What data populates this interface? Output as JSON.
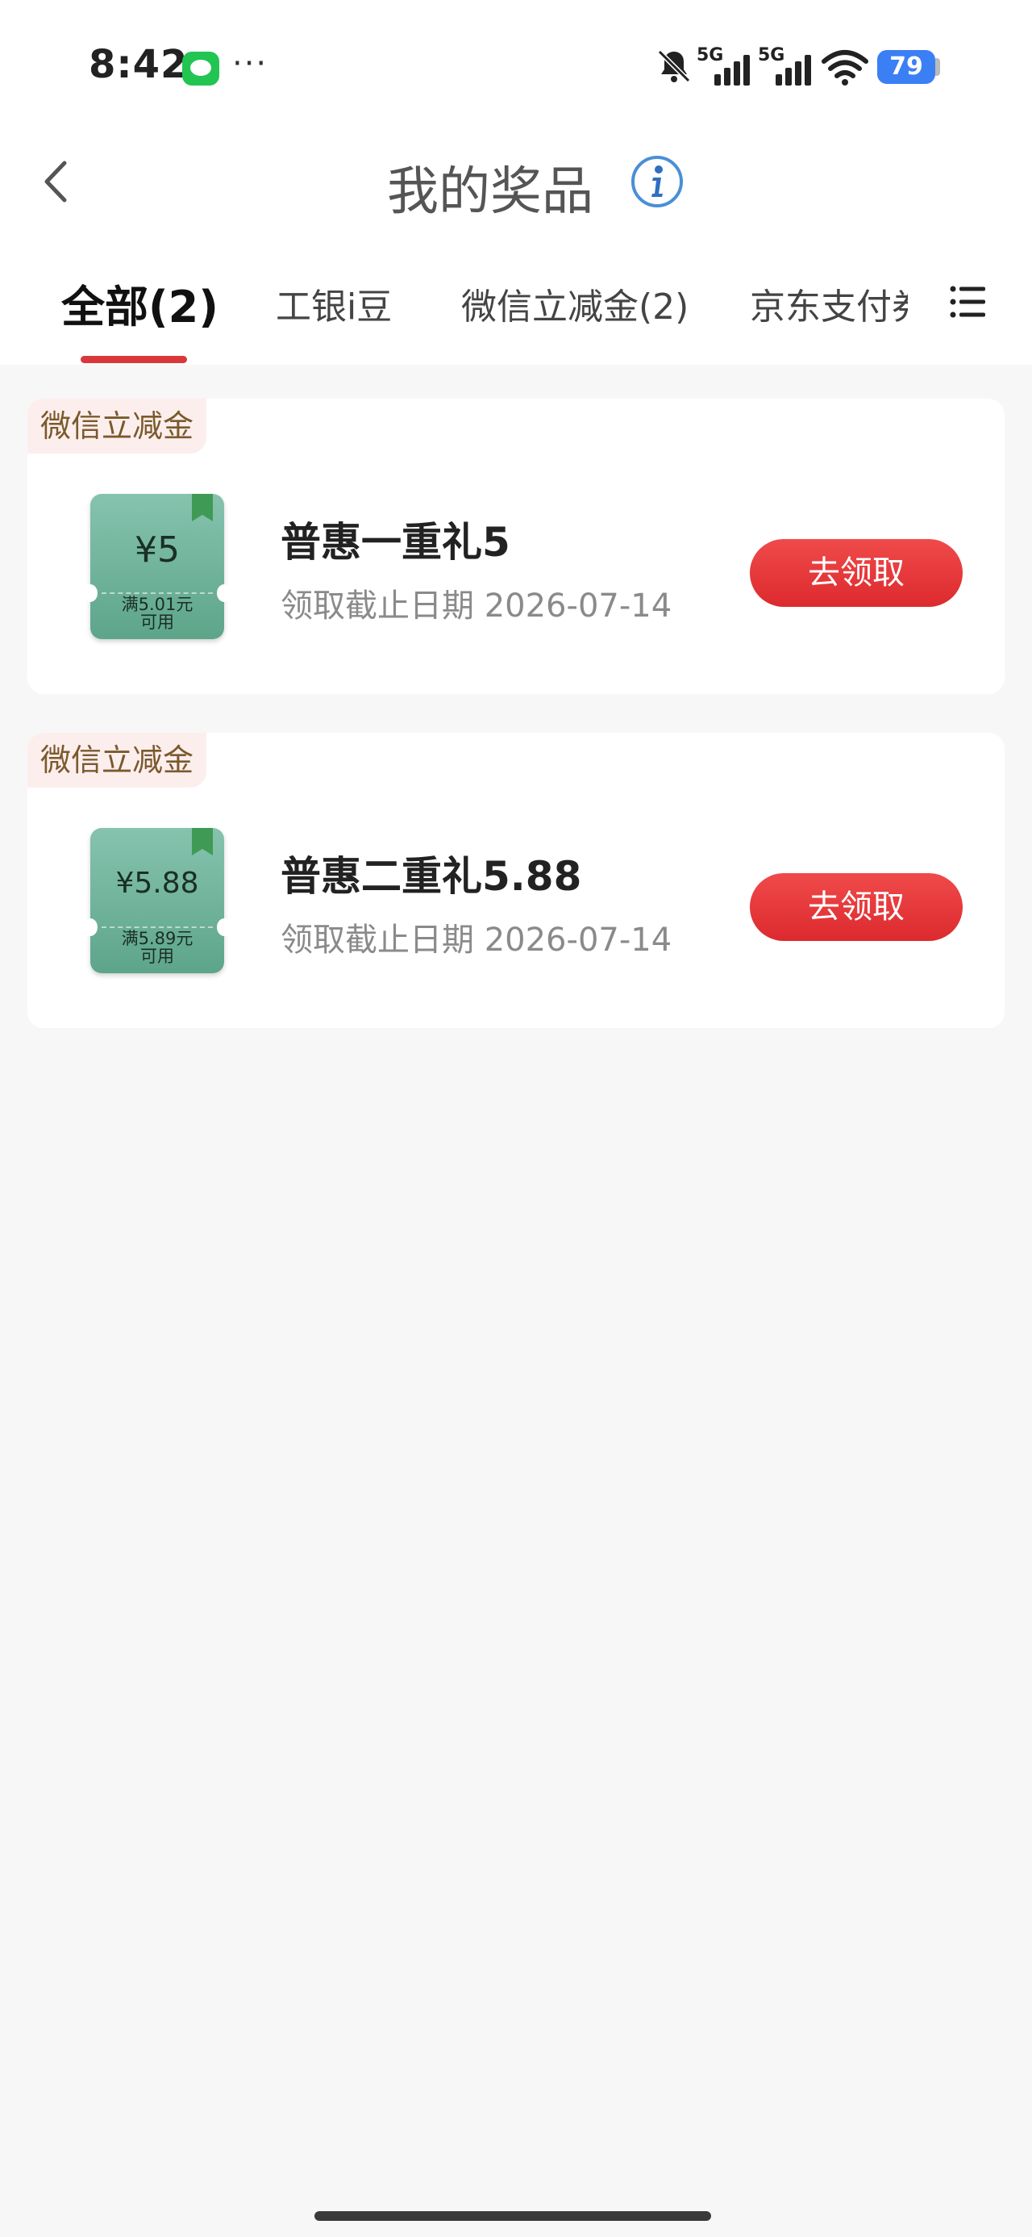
{
  "status_bar": {
    "time": "8:42",
    "dots": "···",
    "signal1_label": "5G",
    "signal2_label": "5G",
    "battery": "79",
    "icons": [
      "message-icon",
      "mute-icon",
      "signal-icon",
      "wifi-icon",
      "battery-icon"
    ]
  },
  "header": {
    "title": "我的奖品",
    "icons": [
      "back-icon",
      "info-icon"
    ]
  },
  "tabs": [
    {
      "label": "全部(2)",
      "active": true
    },
    {
      "label": "工银i豆",
      "active": false
    },
    {
      "label": "微信立减金(2)",
      "active": false
    },
    {
      "label": "京东支付券",
      "active": false
    }
  ],
  "prizes": [
    {
      "category": "微信立减金",
      "ticket_amount": "¥5",
      "ticket_condition_line1": "满5.01元",
      "ticket_condition_line2": "可用",
      "name": "普惠一重礼5",
      "deadline": "领取截止日期 2026-07-14",
      "button_label": "去领取"
    },
    {
      "category": "微信立减金",
      "ticket_amount": "¥5.88",
      "ticket_condition_line1": "满5.89元",
      "ticket_condition_line2": "可用",
      "name": "普惠二重礼5.88",
      "deadline": "领取截止日期 2026-07-14",
      "button_label": "去领取"
    }
  ],
  "colors": {
    "accent": "#d9373a",
    "button": "#e53935",
    "ticket": "#6fb39a",
    "badge_bg": "#fdeeee",
    "badge_text": "#7a5a2c",
    "battery": "#3b7ff5"
  }
}
